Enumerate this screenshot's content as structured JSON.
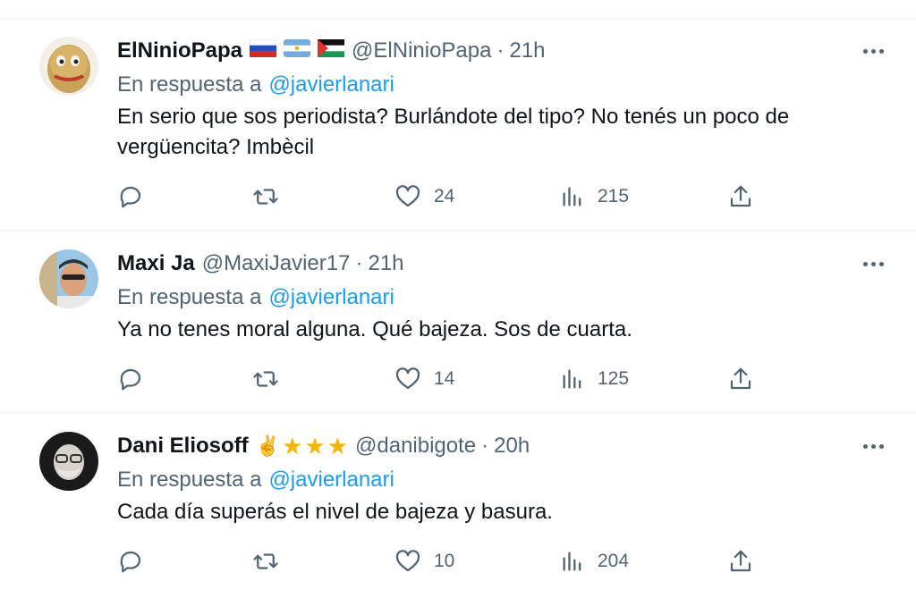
{
  "tweets": [
    {
      "name": "ElNinioPapa",
      "handle": "@ElNinioPapa",
      "time": "21h",
      "reply_prefix": "En respuesta a",
      "reply_to": "@javierlanari",
      "text": "En serio que sos periodista? Burlándote del tipo? No tenés un poco de vergüencita? Imbècil",
      "badges": [
        "flag-russia",
        "flag-argentina",
        "flag-palestine"
      ],
      "likes": "24",
      "views": "215"
    },
    {
      "name": "Maxi Ja",
      "handle": "@MaxiJavier17",
      "time": "21h",
      "reply_prefix": "En respuesta a",
      "reply_to": "@javierlanari",
      "text": "Ya no tenes moral alguna. Qué bajeza. Sos de cuarta.",
      "badges": [],
      "likes": "14",
      "views": "125"
    },
    {
      "name": "Dani Eliosoff",
      "handle": "@danibigote",
      "time": "20h",
      "reply_prefix": "En respuesta a",
      "reply_to": "@javierlanari",
      "text": "Cada día superás el nivel de bajeza y basura.",
      "badges": [
        "✌️",
        "★",
        "★",
        "★"
      ],
      "likes": "10",
      "views": "204"
    }
  ],
  "ui": {
    "dot_separator": "·",
    "icons": [
      "reply-icon",
      "retweet-icon",
      "like-icon",
      "views-icon",
      "share-icon",
      "more-icon"
    ],
    "colors": {
      "text": "#0f1419",
      "secondary": "#536471",
      "link": "#1d9bf0",
      "star": "#f4b400"
    }
  }
}
